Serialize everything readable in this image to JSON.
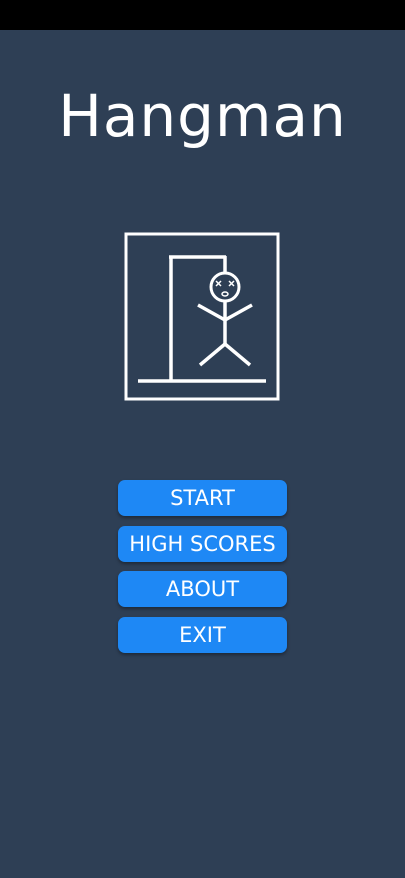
{
  "app": {
    "title": "Hangman"
  },
  "logo": {
    "icon": "hangman-gallows-icon"
  },
  "menu": {
    "start_label": "START",
    "high_scores_label": "HIGH SCORES",
    "about_label": "ABOUT",
    "exit_label": "EXIT"
  },
  "colors": {
    "background": "#2e3f55",
    "button": "#1e88f5",
    "text": "#ffffff",
    "status_bar": "#000000"
  }
}
